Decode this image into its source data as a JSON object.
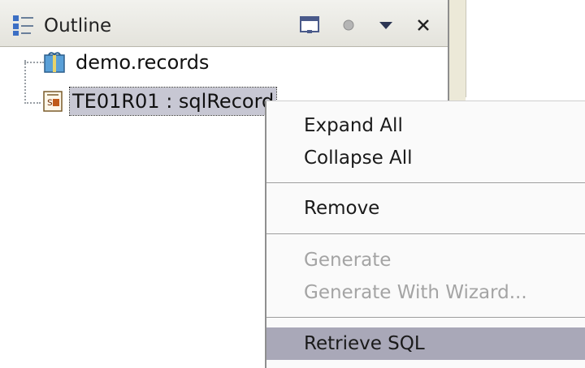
{
  "outline_view": {
    "title": "Outline",
    "icons": {
      "view_icon": "outline-icon",
      "minimize": "minimize-icon",
      "menu_dot": "dot-icon",
      "view_menu": "chevron-down-icon",
      "close": "close-icon"
    }
  },
  "tree": {
    "items": [
      {
        "label": "demo.records",
        "icon": "package-icon"
      },
      {
        "label": "TE01R01 : sqlRecord",
        "icon": "record-icon",
        "selected": true
      }
    ]
  },
  "context_menu": {
    "items": [
      {
        "label": "Expand All",
        "enabled": true
      },
      {
        "label": "Collapse All",
        "enabled": true
      },
      {
        "label": "Remove",
        "enabled": true
      },
      {
        "label": "Generate",
        "enabled": false
      },
      {
        "label": "Generate With Wizard...",
        "enabled": false
      },
      {
        "label": "Retrieve SQL",
        "enabled": true,
        "highlighted": true
      }
    ]
  },
  "colors": {
    "selection": "#c7c7d3",
    "menu_highlight": "#a9a8b8",
    "disabled_text": "#a4a4a4"
  }
}
